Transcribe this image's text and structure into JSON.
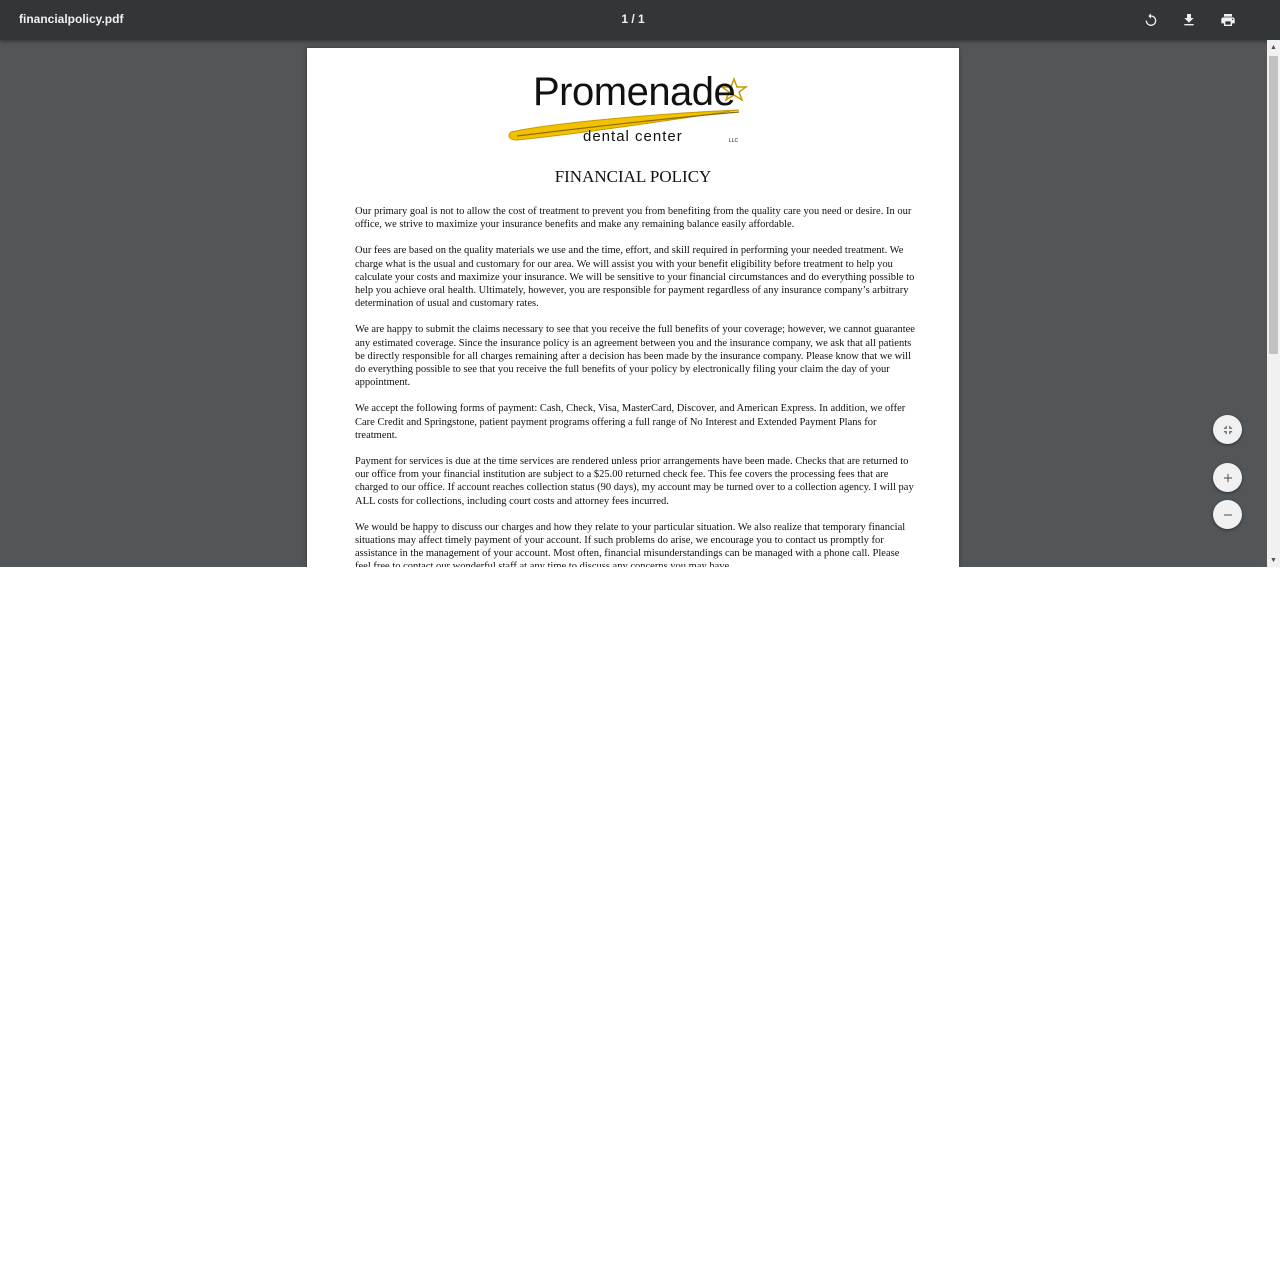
{
  "toolbar": {
    "title": "financialpolicy.pdf",
    "page_indicator": "1 / 1",
    "icons": [
      "rotate-icon",
      "download-icon",
      "print-icon"
    ]
  },
  "document": {
    "logo": {
      "wordmark": "Promenade",
      "subtitle": "dental center",
      "suffix": "LLC",
      "colors": {
        "swoosh": "#f2c200",
        "swoosh_shadow": "#c79a00",
        "text": "#111111"
      }
    },
    "heading": "FINANCIAL POLICY",
    "paragraphs": [
      "Our primary goal is not to allow the cost of treatment to prevent you from benefiting from the quality care you need or desire. In our office, we strive to maximize your insurance benefits and make any remaining balance easily affordable.",
      "Our fees are based on the quality materials we use and the time, effort, and skill required in performing your needed treatment. We charge what is the usual and customary for our area. We will assist you with your benefit eligibility before treatment to help you calculate your costs and maximize your insurance. We will be sensitive to your financial circumstances and do everything possible to help you achieve oral health. Ultimately, however, you are responsible for payment regardless of any insurance company’s arbitrary determination of usual and customary rates.",
      "We are happy to submit the claims necessary to see that you receive the full benefits of your coverage; however, we cannot guarantee any estimated coverage. Since the insurance policy is an agreement between you and the insurance company, we ask that all patients be directly responsible for all charges remaining after a decision has been made by the insurance company. Please know that we will do everything possible to see that you receive the full benefits of your policy by electronically filing your claim the day of your appointment.",
      "We accept the following forms of payment: Cash, Check, Visa, MasterCard, Discover, and American Express. In addition, we offer Care Credit and Springstone, patient payment programs offering a full range of No Interest and Extended Payment Plans for treatment.",
      "Payment for services is due at the time services are rendered unless prior arrangements have been made. Checks that are returned to our office from your financial institution are subject to a $25.00 returned check fee. This fee covers the processing fees that are charged to our office. If account reaches collection status (90 days), my account may be turned over to a collection agency. I will pay ALL costs for collections, including court costs and attorney fees incurred.",
      "We would be happy to discuss our charges and how they relate to your particular situation. We also realize that temporary financial situations may affect timely payment of your account. If such problems do arise, we encourage you to contact us promptly for assistance in the management of your account. Most often, financial misunderstandings can be managed with a phone call. Please feel free to contact our wonderful staff at any time to discuss any concerns you may have."
    ]
  },
  "zoom_controls": {
    "icons": [
      "fit-to-page-icon",
      "zoom-in-icon",
      "zoom-out-icon"
    ]
  },
  "colors": {
    "toolbar_bg": "#323639",
    "viewer_bg": "#525659",
    "page_bg": "#ffffff",
    "fab_bg": "#f1f1f1"
  }
}
